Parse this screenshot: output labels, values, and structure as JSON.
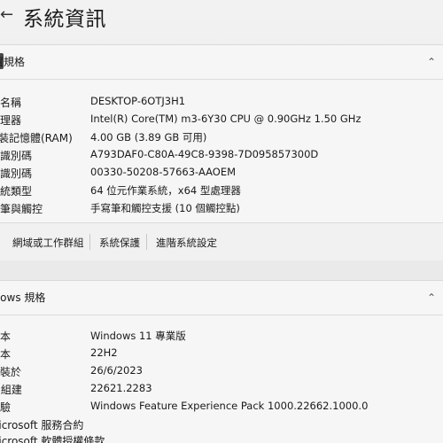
{
  "window": {
    "back_icon": "back-arrow-icon",
    "title": "系統資訊"
  },
  "device_specs": {
    "header": "裝置規格",
    "rows": [
      {
        "label": "裝置名稱",
        "value": "DESKTOP-6OTJ3H1"
      },
      {
        "label": "處理器",
        "value": "Intel(R) Core(TM) m3-6Y30 CPU @ 0.90GHz   1.50 GHz"
      },
      {
        "label": "已安裝記憶體(RAM)",
        "value": "4.00 GB (3.89 GB 可用)"
      },
      {
        "label": "裝置識別碼",
        "value": "A793DAF0-C80A-49C8-9398-7D095857300D"
      },
      {
        "label": "產品識別碼",
        "value": "00330-50208-57663-AAOEM"
      },
      {
        "label": "系統類型",
        "value": "64 位元作業系統，x64 型處理器"
      },
      {
        "label": "手寫筆與觸控",
        "value": "手寫筆和觸控支援 (10 個觸控點)"
      }
    ],
    "links": [
      "網域或工作群組",
      "系統保護",
      "進階系統設定"
    ]
  },
  "windows_specs": {
    "header": "Windows 規格",
    "rows": [
      {
        "label": "版本",
        "value": "Windows 11 專業版"
      },
      {
        "label": "版本",
        "value": "22H2"
      },
      {
        "label": "安裝於",
        "value": "26/6/2023"
      },
      {
        "label": "OS 組建",
        "value": "22621.2283"
      },
      {
        "label": "體驗",
        "value": "Windows Feature Experience Pack 1000.22662.1000.0"
      },
      {
        "label": "Microsoft 服務合約",
        "value": ""
      },
      {
        "label": "Microsoft 軟體授權條款",
        "value": ""
      }
    ]
  }
}
